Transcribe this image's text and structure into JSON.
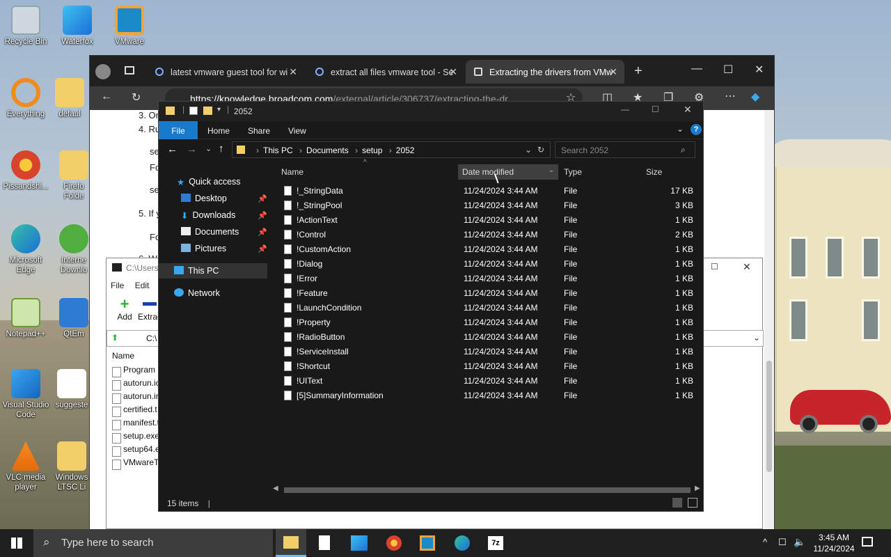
{
  "desktop": {
    "icons": [
      {
        "label": "Recycle Bin"
      },
      {
        "label": "Waterfox"
      },
      {
        "label": "VMware"
      },
      {
        "label": "Everything"
      },
      {
        "label": "defaul"
      },
      {
        "label": "Pissandshi..."
      },
      {
        "label": "Firefo Folde"
      },
      {
        "label": "Microsoft Edge"
      },
      {
        "label": "Interne Downlo"
      },
      {
        "label": "Notepad++"
      },
      {
        "label": "QtEm"
      },
      {
        "label": "Visual Studio Code"
      },
      {
        "label": "suggeste"
      },
      {
        "label": "VLC media player"
      },
      {
        "label": "Windows LTSC Li"
      }
    ]
  },
  "browser": {
    "tabs": [
      {
        "title": "latest vmware guest tool for wi"
      },
      {
        "title": "extract all files vmware tool - Se"
      },
      {
        "title": "Extracting the drivers from VMw"
      }
    ],
    "url_domain": "https://knowledge.broadcom.com",
    "url_path": "/external/article/306737/extracting-the-dr...",
    "content_lines": [
      {
        "text": "3. Or"
      },
      {
        "text": "4. Ru"
      },
      {
        "text": "se"
      },
      {
        "text": "Fo"
      },
      {
        "text": "se"
      },
      {
        "text": "5. If y"
      },
      {
        "text": "Fo"
      },
      {
        "text": "6. W"
      }
    ]
  },
  "sevenzip": {
    "title": "C:\\Users",
    "menu": [
      "File",
      "Edit"
    ],
    "toolbar": {
      "add": "Add",
      "extract": "Extrac"
    },
    "path": "C:\\",
    "column": "Name",
    "files": [
      "Program",
      "autorun.ic",
      "autorun.in",
      "certified.t",
      "manifest.t",
      "setup.exe",
      "setup64.e",
      "VMwareTo"
    ]
  },
  "explorer": {
    "title": "2052",
    "ribbon": {
      "file": "File",
      "home": "Home",
      "share": "Share",
      "view": "View"
    },
    "breadcrumb": [
      "This PC",
      "Documents",
      "setup",
      "2052"
    ],
    "search_placeholder": "Search 2052",
    "nav": {
      "quick_access": "Quick access",
      "desktop": "Desktop",
      "downloads": "Downloads",
      "documents": "Documents",
      "pictures": "Pictures",
      "this_pc": "This PC",
      "network": "Network"
    },
    "columns": {
      "name": "Name",
      "date": "Date modified",
      "type": "Type",
      "size": "Size"
    },
    "files": [
      {
        "name": "!_StringData",
        "date": "11/24/2024 3:44 AM",
        "type": "File",
        "size": "17 KB"
      },
      {
        "name": "!_StringPool",
        "date": "11/24/2024 3:44 AM",
        "type": "File",
        "size": "3 KB"
      },
      {
        "name": "!ActionText",
        "date": "11/24/2024 3:44 AM",
        "type": "File",
        "size": "1 KB"
      },
      {
        "name": "!Control",
        "date": "11/24/2024 3:44 AM",
        "type": "File",
        "size": "2 KB"
      },
      {
        "name": "!CustomAction",
        "date": "11/24/2024 3:44 AM",
        "type": "File",
        "size": "1 KB"
      },
      {
        "name": "!Dialog",
        "date": "11/24/2024 3:44 AM",
        "type": "File",
        "size": "1 KB"
      },
      {
        "name": "!Error",
        "date": "11/24/2024 3:44 AM",
        "type": "File",
        "size": "1 KB"
      },
      {
        "name": "!Feature",
        "date": "11/24/2024 3:44 AM",
        "type": "File",
        "size": "1 KB"
      },
      {
        "name": "!LaunchCondition",
        "date": "11/24/2024 3:44 AM",
        "type": "File",
        "size": "1 KB"
      },
      {
        "name": "!Property",
        "date": "11/24/2024 3:44 AM",
        "type": "File",
        "size": "1 KB"
      },
      {
        "name": "!RadioButton",
        "date": "11/24/2024 3:44 AM",
        "type": "File",
        "size": "1 KB"
      },
      {
        "name": "!ServiceInstall",
        "date": "11/24/2024 3:44 AM",
        "type": "File",
        "size": "1 KB"
      },
      {
        "name": "!Shortcut",
        "date": "11/24/2024 3:44 AM",
        "type": "File",
        "size": "1 KB"
      },
      {
        "name": "!UIText",
        "date": "11/24/2024 3:44 AM",
        "type": "File",
        "size": "1 KB"
      },
      {
        "name": "[5]SummaryInformation",
        "date": "11/24/2024 3:44 AM",
        "type": "File",
        "size": "1 KB"
      }
    ],
    "status": "15 items"
  },
  "taskbar": {
    "search_placeholder": "Type here to search",
    "time": "3:45 AM",
    "date": "11/24/2024"
  },
  "colors": {
    "accent": "#1979ca",
    "explorer_bg": "#191919",
    "taskbar_bg": "#1f1f1f"
  }
}
